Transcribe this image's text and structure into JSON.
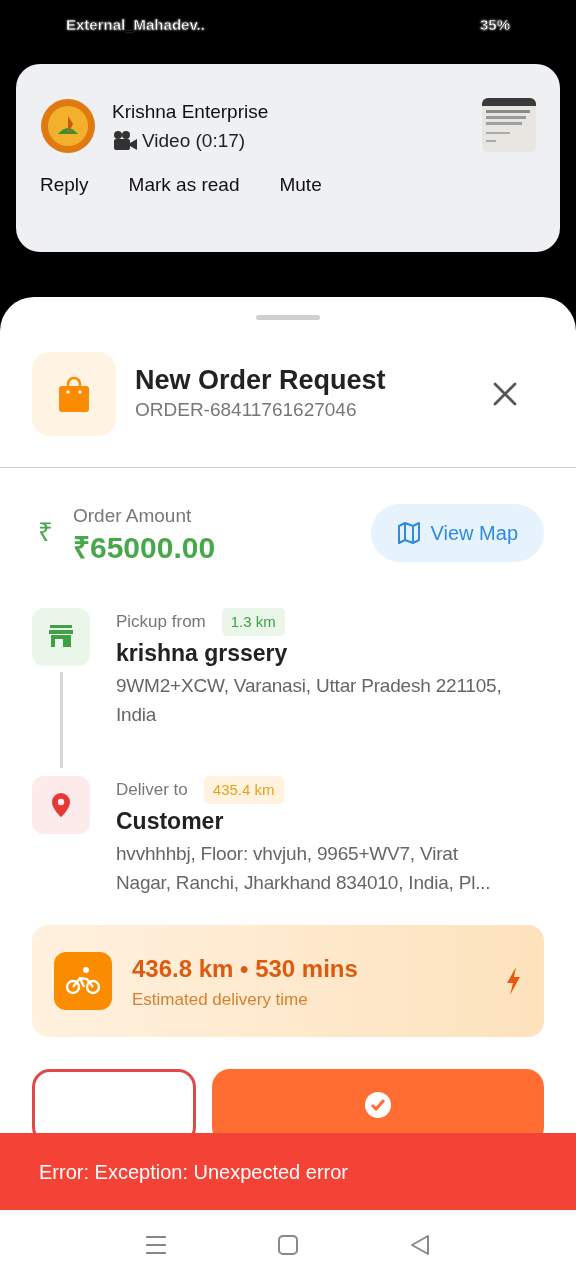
{
  "status_bar": {
    "carrier": "External_Mahadev..",
    "battery": "35%"
  },
  "notification": {
    "sender": "Krishna Enterprise",
    "message": "Video (0:17)",
    "actions": [
      "Reply",
      "Mark as read",
      "Mute"
    ]
  },
  "sheet": {
    "title": "New Order Request",
    "order_id": "ORDER-68411761627046",
    "currency_symbol": "₹",
    "amount_label": "Order Amount",
    "amount": "₹65000.00",
    "map_button": "View Map",
    "stops": [
      {
        "kind": "pickup",
        "label": "Pickup from",
        "distance": "1.3 km",
        "name": "krishna grssery",
        "address": "9WM2+XCW, Varanasi, Uttar Pradesh 221105, India"
      },
      {
        "kind": "delivery",
        "label": "Deliver to",
        "distance": "435.4 km",
        "name": "Customer",
        "address": "hvvhhhbj, Floor: vhvjuh, 9965+WV7, Virat Nagar, Ranchi, Jharkhand 834010, India, Pl..."
      }
    ],
    "eta": {
      "summary": "436.8 km • 530 mins",
      "caption": "Estimated delivery time"
    },
    "actions": [
      {
        "kind": "reject"
      },
      {
        "kind": "accept"
      }
    ]
  },
  "snackbar": {
    "message": "Error: Exception: Unexpected error"
  }
}
